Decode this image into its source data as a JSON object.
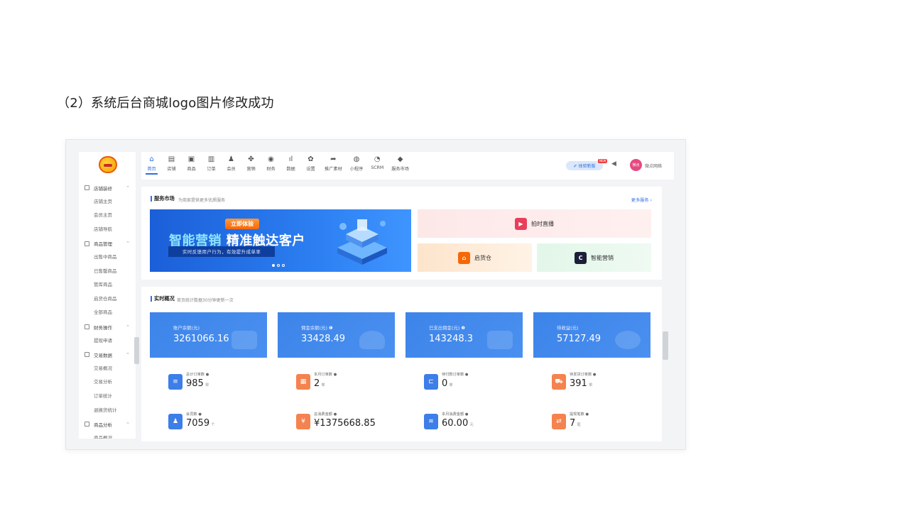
{
  "heading": "（2）系统后台商城logo图片修改成功",
  "sidebar": {
    "groups": [
      {
        "label": "店铺装修",
        "items": [
          "店铺主页",
          "会员主页",
          "店铺导航"
        ]
      },
      {
        "label": "商品管理",
        "items": [
          "出售中商品",
          "已售罄商品",
          "管库商品",
          "启货仓商品",
          "全部商品"
        ]
      },
      {
        "label": "财务操作",
        "items": [
          "提现申请"
        ]
      },
      {
        "label": "交易数据",
        "items": [
          "交易概况",
          "交易分析",
          "订单统计",
          "退换货统计"
        ]
      },
      {
        "label": "商品分析",
        "items": [
          "商品概况"
        ]
      }
    ]
  },
  "topnav": {
    "items": [
      {
        "label": "首页",
        "icon": "⌂",
        "icon_name": "home-icon"
      },
      {
        "label": "店铺",
        "icon": "▤",
        "icon_name": "store-icon"
      },
      {
        "label": "商品",
        "icon": "▣",
        "icon_name": "goods-icon"
      },
      {
        "label": "订单",
        "icon": "▥",
        "icon_name": "order-icon"
      },
      {
        "label": "会员",
        "icon": "♟",
        "icon_name": "member-icon"
      },
      {
        "label": "营销",
        "icon": "✤",
        "icon_name": "marketing-icon"
      },
      {
        "label": "财务",
        "icon": "◉",
        "icon_name": "finance-icon"
      },
      {
        "label": "数据",
        "icon": "ıl",
        "icon_name": "data-icon"
      },
      {
        "label": "设置",
        "icon": "✿",
        "icon_name": "settings-icon"
      },
      {
        "label": "推广素材",
        "icon": "➦",
        "icon_name": "promo-icon"
      },
      {
        "label": "小程序",
        "icon": "◍",
        "icon_name": "miniapp-icon"
      },
      {
        "label": "SCRM",
        "icon": "◔",
        "icon_name": "scrm-icon"
      },
      {
        "label": "服务市场",
        "icon": "◆",
        "icon_name": "service-icon"
      }
    ],
    "trial": "✐ 体验新版",
    "new_badge": "NEW",
    "user_avatar": "微点",
    "user_name": "微点网络"
  },
  "services": {
    "title": "服务市场",
    "subtitle": "为商家提供更多优质服务",
    "more": "更多服务 ›",
    "banner": {
      "tag": "立即体验",
      "headline_a": "智能营销",
      "headline_b": "精准触达客户",
      "strip": "实时反馈用户行为，有效提升成单率"
    },
    "tiles": {
      "live": {
        "label": "拍时直播",
        "icon": "▶"
      },
      "ship": {
        "label": "启货仓",
        "icon": "⌂"
      },
      "marketing": {
        "label": "智能营销",
        "icon": "C"
      }
    }
  },
  "realtime": {
    "title": "实时概况",
    "subtitle": "首页统计数据30分钟更新一次",
    "stats": [
      {
        "label": "账户余额(元)",
        "value": "3261066.16"
      },
      {
        "label": "佣金余额(元) ❶",
        "value": "33428.49"
      },
      {
        "label": "已支出佣金(元) ❶",
        "value": "143248.3"
      },
      {
        "label": "待收益(元)",
        "value": "57127.49"
      }
    ],
    "metrics": [
      {
        "label": "总计订单数 ●",
        "value": "985",
        "unit": "单",
        "icon": "≡",
        "color": "#3d7ee8"
      },
      {
        "label": "本月订单数 ●",
        "value": "2",
        "unit": "单",
        "icon": "▦",
        "color": "#f4834f"
      },
      {
        "label": "待付款订单数 ●",
        "value": "0",
        "unit": "单",
        "icon": "⊏",
        "color": "#3d7ee8"
      },
      {
        "label": "待发货订单数 ●",
        "value": "391",
        "unit": "单",
        "icon": "⛟",
        "color": "#f4834f"
      },
      {
        "label": "会员数 ●",
        "value": "7059",
        "unit": "个",
        "icon": "♟",
        "color": "#3d7ee8"
      },
      {
        "label": "总消费金额 ●",
        "value": "¥1375668.85",
        "unit": "",
        "icon": "¥",
        "color": "#f4834f"
      },
      {
        "label": "本月消费金额 ●",
        "value": "60.00",
        "unit": "元",
        "icon": "≋",
        "color": "#3d7ee8"
      },
      {
        "label": "提现笔数 ●",
        "value": "7",
        "unit": "笔",
        "icon": "⇄",
        "color": "#f4834f"
      }
    ]
  }
}
